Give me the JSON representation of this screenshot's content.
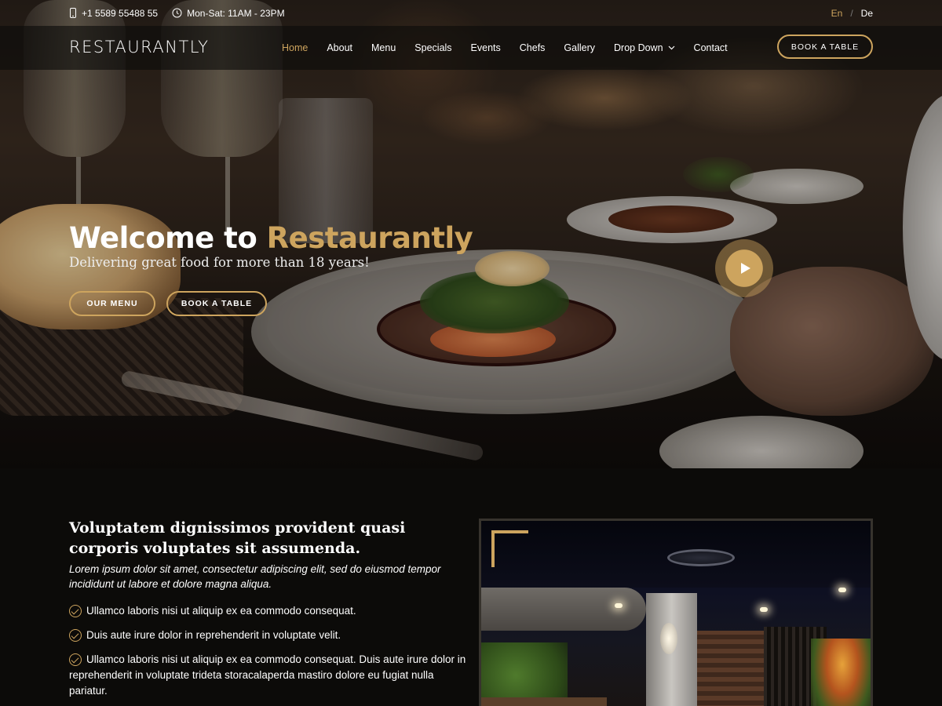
{
  "topbar": {
    "phone": "+1 5589 55488 55",
    "hours": "Mon-Sat: 11AM - 23PM",
    "languages": [
      {
        "code": "En",
        "active": true
      },
      {
        "code": "De",
        "active": false
      }
    ],
    "separator": "/"
  },
  "header": {
    "logo": "RESTAURANTLY",
    "nav": [
      {
        "label": "Home",
        "active": true
      },
      {
        "label": "About",
        "active": false
      },
      {
        "label": "Menu",
        "active": false
      },
      {
        "label": "Specials",
        "active": false
      },
      {
        "label": "Events",
        "active": false
      },
      {
        "label": "Chefs",
        "active": false
      },
      {
        "label": "Gallery",
        "active": false
      },
      {
        "label": "Drop Down",
        "active": false,
        "has_dropdown": true
      },
      {
        "label": "Contact",
        "active": false
      }
    ],
    "cta": "BOOK A TABLE"
  },
  "hero": {
    "title_prefix": "Welcome to",
    "title_accent": "Restaurantly",
    "subtitle": "Delivering great food for more than 18 years!",
    "buttons": {
      "menu": "OUR MENU",
      "book": "BOOK A TABLE"
    },
    "play_icon": "play-icon"
  },
  "about": {
    "title": "Voluptatem dignissimos provident quasi corporis voluptates sit assumenda.",
    "lead": "Lorem ipsum dolor sit amet, consectetur adipiscing elit, sed do eiusmod tempor incididunt ut labore et dolore magna aliqua.",
    "items": [
      "Ullamco laboris nisi ut aliquip ex ea commodo consequat.",
      "Duis aute irure dolor in reprehenderit in voluptate velit.",
      "Ullamco laboris nisi ut aliquip ex ea commodo consequat. Duis aute irure dolor in reprehenderit in voluptate trideta storacalaperda mastiro dolore eu fugiat nulla pariatur."
    ]
  },
  "colors": {
    "accent": "#cda45e",
    "background": "#0c0b09",
    "text": "#ffffff"
  }
}
